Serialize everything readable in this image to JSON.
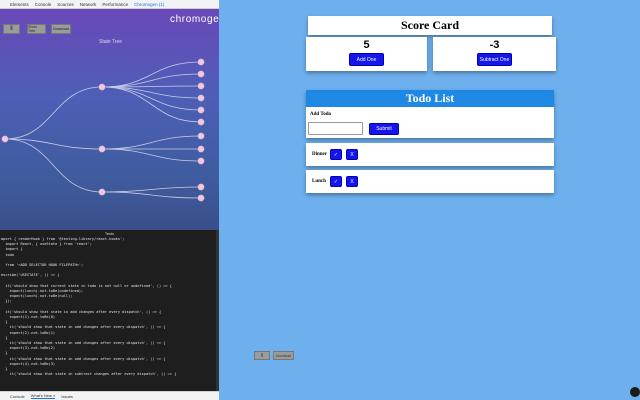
{
  "devtools": {
    "tabs": [
      "Elements",
      "Console",
      "Sources",
      "Network",
      "Performance",
      "Chromogen (1)"
    ],
    "active_tab": 5,
    "drawer_tabs": [
      "Console",
      "What's New ×",
      "Issues"
    ]
  },
  "chromogen": {
    "title": "chromogen",
    "pause_label": "‖",
    "show_tree_label": "Show Tree",
    "download_label": "Download",
    "state_tree_label": "State Tree",
    "node_color": "#f3c6de",
    "link_color": "#c7cde8"
  },
  "tests": {
    "title": "Tests",
    "code_lines": [
      "mport { renderHook } from '@testing-library/react-hooks';",
      "  import React, { useState } from 'react';",
      "  import {",
      "  todo",
      "",
      "  from '<ADD SELECTOR HOOK FILEPATH>';",
      "",
      "escribe('USESTATE', () => {",
      "",
      "  it('should show that current state in todo is not null or undefined', () => {",
      "    expect(lunch).not.toBe(undefined);",
      "    expect(lunch).not.toBe(null);",
      "  });",
      "",
      "  it('should show that state in add changes after every dispatch', () => {",
      "    expect(1).not.toBe(0)",
      "  }",
      "    it('should show that state in add changes after every dispatch', () => {",
      "    expect(2).not.toBe(1)",
      "  }",
      "    it('should show that state in add changes after every dispatch', () => {",
      "    expect(3).not.toBe(2)",
      "  }",
      "    it('should show that state in add changes after every dispatch', () => {",
      "    expect(4).not.toBe(3)",
      "  }",
      "    it('should show that state in subtract changes after every dispatch', () => {"
    ]
  },
  "score_card": {
    "title": "Score Card",
    "left_value": "5",
    "add_label": "Add One",
    "right_value": "-3",
    "subtract_label": "Subtract One"
  },
  "todo": {
    "title": "Todo List",
    "add_label": "Add Todo",
    "input_value": "",
    "submit_label": "Submit",
    "items": [
      {
        "name": "Dinner",
        "check": "✓",
        "delete": "X"
      },
      {
        "name": "Lunch",
        "check": "✓",
        "delete": "X"
      }
    ]
  },
  "controls": {
    "pause_label": "‖",
    "download_label": "Download"
  },
  "colors": {
    "page_bg": "#6eb0ee",
    "button_blue": "#1515ee",
    "todo_header": "#1e88e5"
  }
}
